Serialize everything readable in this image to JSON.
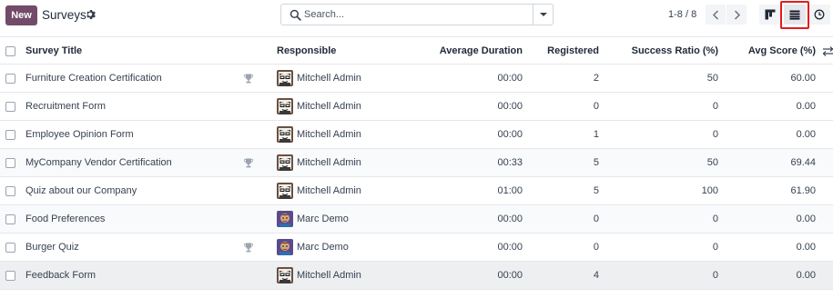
{
  "control_panel": {
    "new_label": "New",
    "title": "Surveys",
    "search_placeholder": "Search...",
    "pager": "1-8 / 8",
    "accent_color": "#714B67",
    "highlight_color": "#e51c1c"
  },
  "table": {
    "headers": {
      "title": "Survey Title",
      "responsible": "Responsible",
      "duration": "Average Duration",
      "registered": "Registered",
      "success": "Success Ratio (%)",
      "avg_score": "Avg Score (%)"
    },
    "rows": [
      {
        "title": "Furniture Creation Certification",
        "certification": true,
        "responsible": "Mitchell Admin",
        "avatar": "mitchell",
        "duration": "00:00",
        "registered": "2",
        "success": "50",
        "avg_score": "60.00"
      },
      {
        "title": "Recruitment Form",
        "certification": false,
        "responsible": "Mitchell Admin",
        "avatar": "mitchell",
        "duration": "00:00",
        "registered": "0",
        "success": "0",
        "avg_score": "0.00"
      },
      {
        "title": "Employee Opinion Form",
        "certification": false,
        "responsible": "Mitchell Admin",
        "avatar": "mitchell",
        "duration": "00:00",
        "registered": "1",
        "success": "0",
        "avg_score": "0.00"
      },
      {
        "title": "MyCompany Vendor Certification",
        "certification": true,
        "responsible": "Mitchell Admin",
        "avatar": "mitchell",
        "duration": "00:33",
        "registered": "5",
        "success": "50",
        "avg_score": "69.44"
      },
      {
        "title": "Quiz about our Company",
        "certification": false,
        "responsible": "Mitchell Admin",
        "avatar": "mitchell",
        "duration": "01:00",
        "registered": "5",
        "success": "100",
        "avg_score": "61.90"
      },
      {
        "title": "Food Preferences",
        "certification": false,
        "responsible": "Marc Demo",
        "avatar": "marc",
        "duration": "00:00",
        "registered": "0",
        "success": "0",
        "avg_score": "0.00"
      },
      {
        "title": "Burger Quiz",
        "certification": true,
        "responsible": "Marc Demo",
        "avatar": "marc",
        "duration": "00:00",
        "registered": "0",
        "success": "0",
        "avg_score": "0.00"
      },
      {
        "title": "Feedback Form",
        "certification": false,
        "responsible": "Mitchell Admin",
        "avatar": "mitchell",
        "duration": "00:00",
        "registered": "4",
        "success": "0",
        "avg_score": "0.00"
      }
    ]
  },
  "icons": {
    "settings": "gear-icon",
    "search": "search-icon",
    "toggle": "caret-down-icon",
    "prev": "chevron-left-icon",
    "next": "chevron-right-icon",
    "kanban": "kanban-view-icon",
    "list": "list-view-icon",
    "activity": "clock-icon",
    "certification": "trophy-icon",
    "optional_columns": "sliders-icon"
  }
}
